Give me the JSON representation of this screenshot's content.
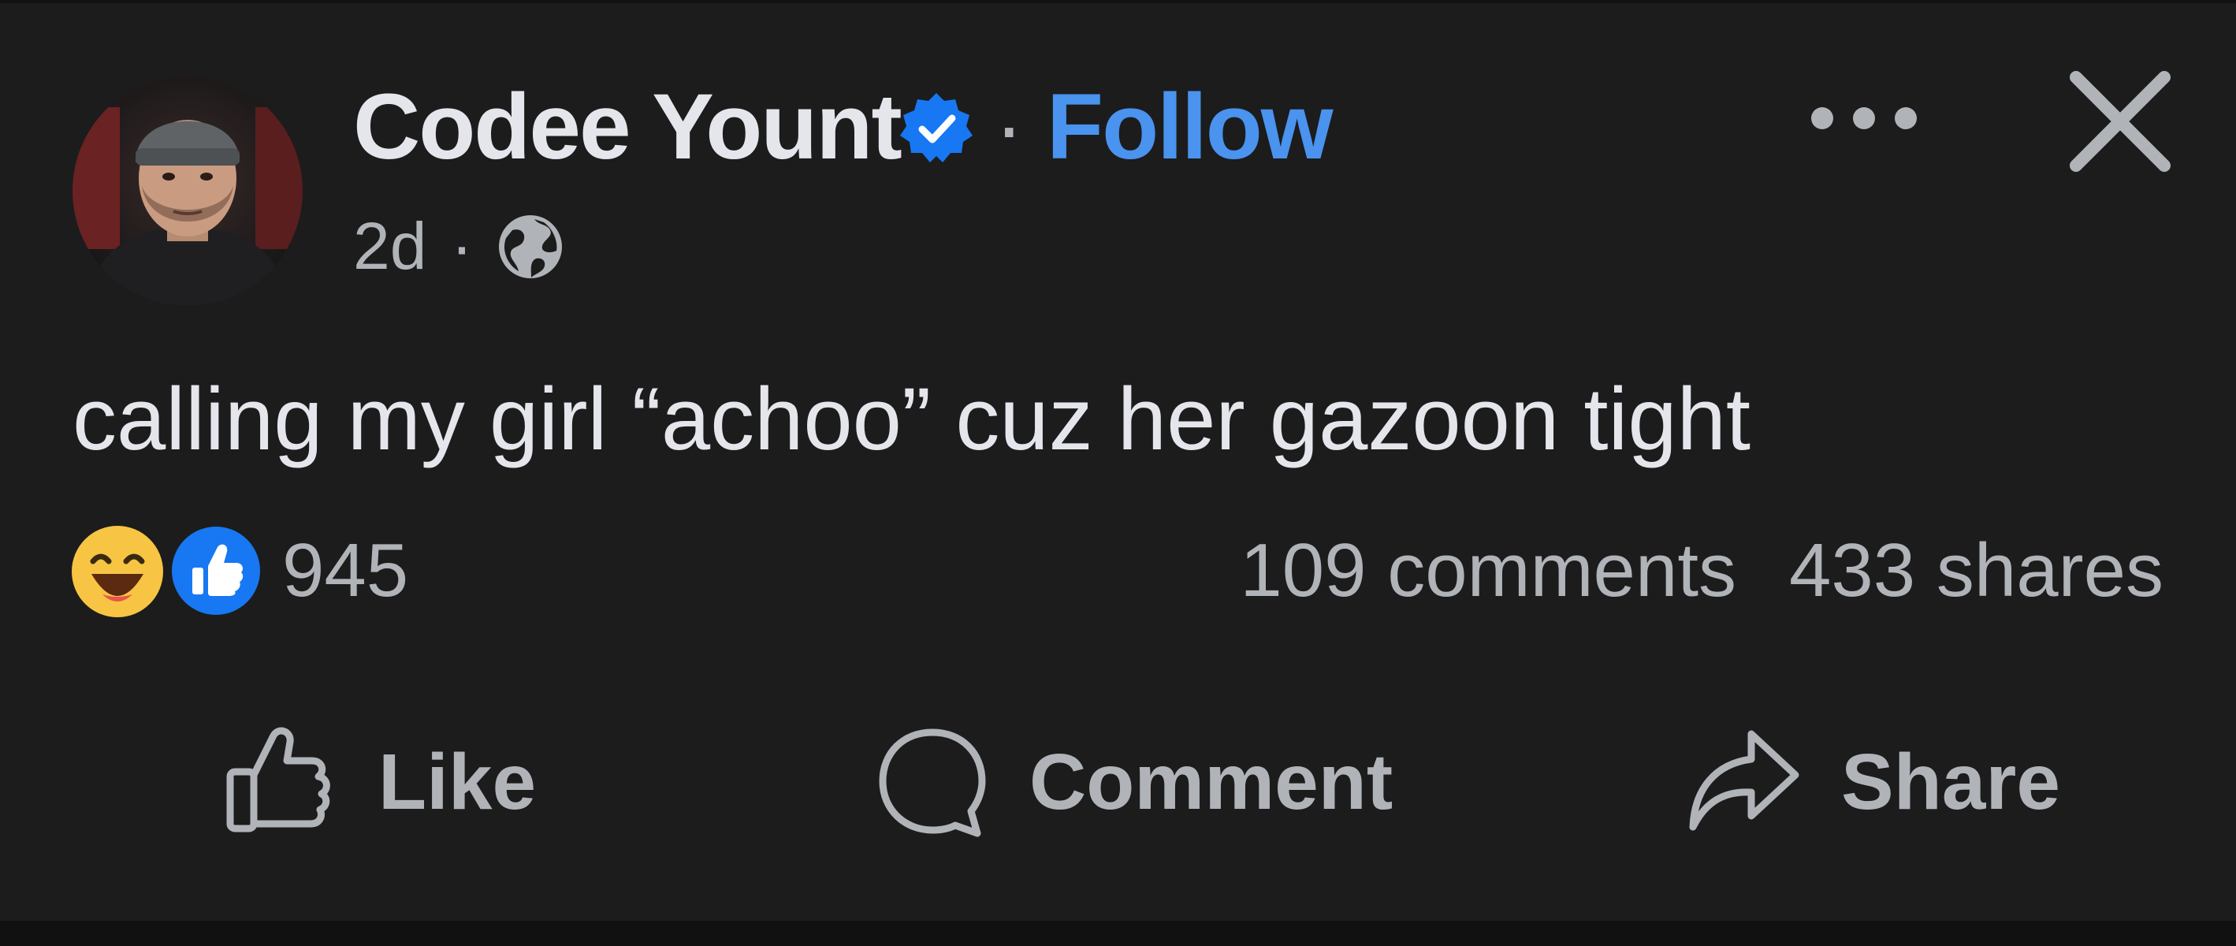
{
  "post": {
    "author": {
      "name": "Codee Yount",
      "verified_icon": "verified-badge-icon",
      "follow_label": "Follow",
      "avatar": "profile-photo"
    },
    "meta": {
      "time": "2d",
      "separator": "·",
      "privacy_icon": "globe-icon"
    },
    "text": "calling my girl “achoo” cuz her gazoon tight",
    "reactions": {
      "icons": [
        "haha-icon",
        "like-icon"
      ],
      "count": "945"
    },
    "comments_label": "109 comments",
    "shares_label": "433 shares"
  },
  "header_actions": {
    "more_icon": "more-icon",
    "close_icon": "close-icon"
  },
  "actions": {
    "like_label": "Like",
    "comment_label": "Comment",
    "share_label": "Share"
  },
  "colors": {
    "background": "#1c1c1d",
    "primary_text": "#e4e6eb",
    "secondary_text": "#b0b3b8",
    "follow_blue": "#4a93ee",
    "verified_blue": "#1877f2",
    "like_blue": "#1877f2",
    "haha_yellow": "#f7c543"
  }
}
